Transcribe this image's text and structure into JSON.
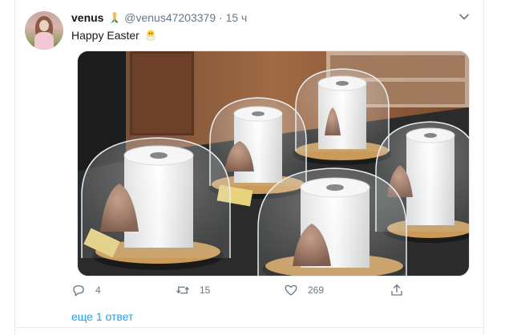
{
  "tweet": {
    "display_name": "venus",
    "handle": "@venus47203379",
    "separator": "·",
    "time": "15 ч",
    "text": "Happy Easter",
    "reply_count": "4",
    "retweet_count": "15",
    "like_count": "269",
    "show_more": "еще 1 ответ"
  },
  "icons": {
    "caret": "chevron-down-icon",
    "reply": "reply-icon",
    "retweet": "retweet-icon",
    "like": "heart-icon",
    "share": "share-icon",
    "name_emoji": "mermaid-icon",
    "text_emoji": "hatching-chick-icon"
  },
  "colors": {
    "link": "#1da1f2",
    "muted": "#657786",
    "text": "#14171a",
    "border": "#e6ecf0"
  }
}
